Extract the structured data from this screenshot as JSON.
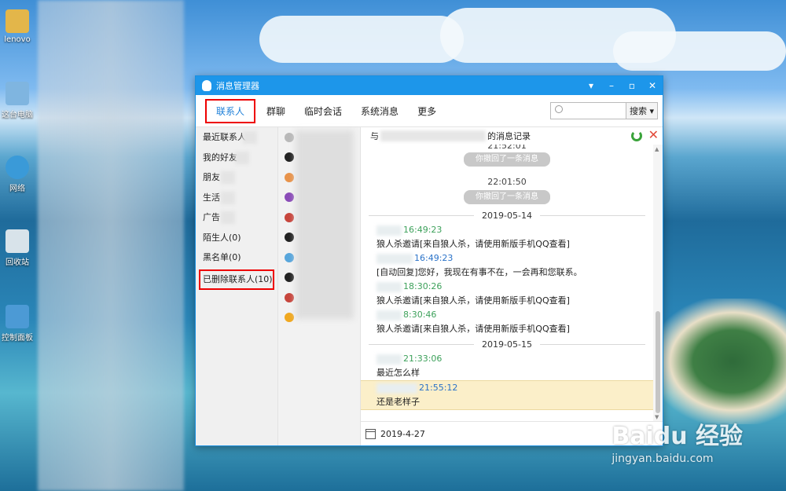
{
  "desktop": {
    "icons": [
      {
        "label": "lenovo",
        "color": "#e3b64a"
      },
      {
        "label": "这台电脑",
        "color": "#7fb5e0"
      },
      {
        "label": "网络",
        "color": "#3a9ad8"
      },
      {
        "label": "回收站",
        "color": "#d8e3ea"
      },
      {
        "label": "控制面板",
        "color": "#4c9ad5"
      }
    ]
  },
  "window": {
    "title": "消息管理器",
    "controls": {
      "menu": "▾",
      "minimize": "–",
      "maximize": "▫",
      "close": "✕"
    }
  },
  "toolbar": {
    "tabs": [
      {
        "label": "联系人",
        "active": true
      },
      {
        "label": "群聊"
      },
      {
        "label": "临时会话"
      },
      {
        "label": "系统消息"
      },
      {
        "label": "更多"
      }
    ],
    "search_placeholder": "",
    "search_button": "搜索 ▾"
  },
  "categories": [
    {
      "label": "最近联系人"
    },
    {
      "label": "我的好友"
    },
    {
      "label": "朋友"
    },
    {
      "label": "生活"
    },
    {
      "label": "广告"
    },
    {
      "label": "陌生人(0)"
    },
    {
      "label": "黑名单(0)"
    },
    {
      "label": "已删除联系人(10)",
      "highlighted": true
    }
  ],
  "contacts": [
    {
      "color": "#b9b9b9"
    },
    {
      "color": "#222222"
    },
    {
      "color": "#e8934a"
    },
    {
      "color": "#8a4bb8"
    },
    {
      "color": "#c7453c"
    },
    {
      "color": "#222222"
    },
    {
      "color": "#58a6dc"
    },
    {
      "color": "#222222"
    },
    {
      "color": "#c7453c"
    },
    {
      "color": "#f0a820"
    }
  ],
  "conversation": {
    "header_prefix": "与",
    "header_suffix": "的消息记录",
    "footer_date": "2019-4-27"
  },
  "messages": {
    "t1": "21:52:01",
    "p1": "你撤回了一条消息",
    "t2": "22:01:50",
    "p2": "你撤回了一条消息",
    "d1": "2019-05-14",
    "m1_time": "16:49:23",
    "m1_text": "狼人杀邀请[来自狼人杀，请使用新版手机QQ查看]",
    "m2_time": "16:49:23",
    "m2_text": "[自动回复]您好，我现在有事不在，一会再和您联系。",
    "m3_time": "18:30:26",
    "m3_text": "狼人杀邀请[来自狼人杀，请使用新版手机QQ查看]",
    "m4_time": "8:30:46",
    "m4_text": "狼人杀邀请[来自狼人杀，请使用新版手机QQ查看]",
    "d2": "2019-05-15",
    "m5_time": "21:33:06",
    "m5_text": "最近怎么样",
    "m6_time": "21:55:12",
    "m6_text": "还是老样子"
  },
  "watermark": {
    "brand": "Baidu 经验",
    "url": "jingyan.baidu.com"
  }
}
